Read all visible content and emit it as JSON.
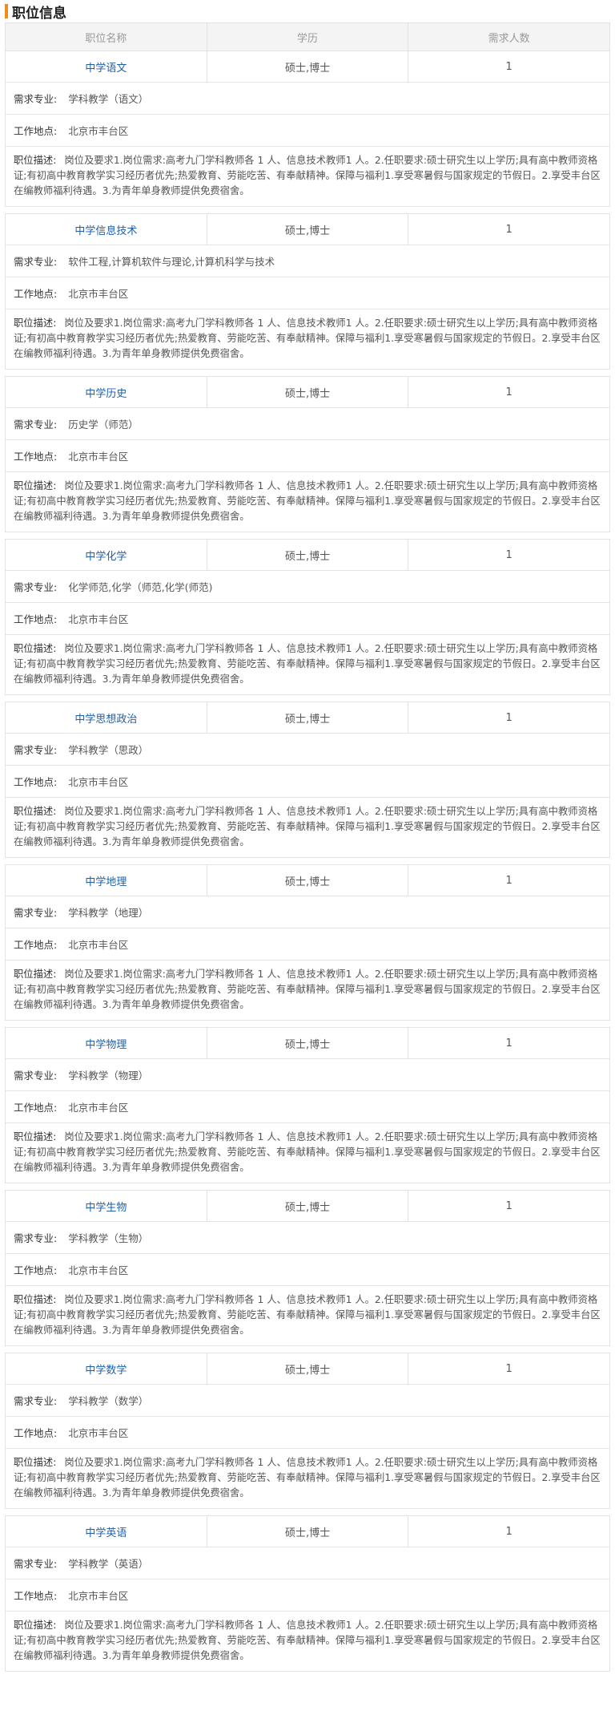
{
  "section": {
    "title": "职位信息"
  },
  "columns": {
    "name": "职位名称",
    "degree": "学历",
    "count": "需求人数"
  },
  "labels": {
    "major": "需求专业:",
    "location": "工作地点:",
    "description": "职位描述:"
  },
  "jobs": [
    {
      "title": "中学语文",
      "degree": "硕士,博士",
      "count": "1",
      "major": "学科教学（语文）",
      "location": "北京市丰台区",
      "description": "岗位及要求1.岗位需求:高考九门学科教师各 1 人、信息技术教师1 人。2.任职要求:硕士研究生以上学历;具有高中教师资格证;有初高中教育教学实习经历者优先;热爱教育、劳能吃苦、有奉献精神。保障与福利1.享受寒暑假与国家规定的节假日。2.享受丰台区在编教师福利待遇。3.为青年单身教师提供免费宿舍。"
    },
    {
      "title": "中学信息技术",
      "degree": "硕士,博士",
      "count": "1",
      "major": "软件工程,计算机软件与理论,计算机科学与技术",
      "location": "北京市丰台区",
      "description": "岗位及要求1.岗位需求:高考九门学科教师各 1 人、信息技术教师1 人。2.任职要求:硕士研究生以上学历;具有高中教师资格证;有初高中教育教学实习经历者优先;热爱教育、劳能吃苦、有奉献精神。保障与福利1.享受寒暑假与国家规定的节假日。2.享受丰台区在编教师福利待遇。3.为青年单身教师提供免费宿舍。"
    },
    {
      "title": "中学历史",
      "degree": "硕士,博士",
      "count": "1",
      "major": "历史学（师范）",
      "location": "北京市丰台区",
      "description": "岗位及要求1.岗位需求:高考九门学科教师各 1 人、信息技术教师1 人。2.任职要求:硕士研究生以上学历;具有高中教师资格证;有初高中教育教学实习经历者优先;热爱教育、劳能吃苦、有奉献精神。保障与福利1.享受寒暑假与国家规定的节假日。2.享受丰台区在编教师福利待遇。3.为青年单身教师提供免费宿舍。"
    },
    {
      "title": "中学化学",
      "degree": "硕士,博士",
      "count": "1",
      "major": "化学师范,化学（师范,化学(师范)",
      "location": "北京市丰台区",
      "description": "岗位及要求1.岗位需求:高考九门学科教师各 1 人、信息技术教师1 人。2.任职要求:硕士研究生以上学历;具有高中教师资格证;有初高中教育教学实习经历者优先;热爱教育、劳能吃苦、有奉献精神。保障与福利1.享受寒暑假与国家规定的节假日。2.享受丰台区在编教师福利待遇。3.为青年单身教师提供免费宿舍。"
    },
    {
      "title": "中学思想政治",
      "degree": "硕士,博士",
      "count": "1",
      "major": "学科教学（思政）",
      "location": "北京市丰台区",
      "description": "岗位及要求1.岗位需求:高考九门学科教师各 1 人、信息技术教师1 人。2.任职要求:硕士研究生以上学历;具有高中教师资格证;有初高中教育教学实习经历者优先;热爱教育、劳能吃苦、有奉献精神。保障与福利1.享受寒暑假与国家规定的节假日。2.享受丰台区在编教师福利待遇。3.为青年单身教师提供免费宿舍。"
    },
    {
      "title": "中学地理",
      "degree": "硕士,博士",
      "count": "1",
      "major": "学科教学（地理）",
      "location": "北京市丰台区",
      "description": "岗位及要求1.岗位需求:高考九门学科教师各 1 人、信息技术教师1 人。2.任职要求:硕士研究生以上学历;具有高中教师资格证;有初高中教育教学实习经历者优先;热爱教育、劳能吃苦、有奉献精神。保障与福利1.享受寒暑假与国家规定的节假日。2.享受丰台区在编教师福利待遇。3.为青年单身教师提供免费宿舍。"
    },
    {
      "title": "中学物理",
      "degree": "硕士,博士",
      "count": "1",
      "major": "学科教学（物理）",
      "location": "北京市丰台区",
      "description": "岗位及要求1.岗位需求:高考九门学科教师各 1 人、信息技术教师1 人。2.任职要求:硕士研究生以上学历;具有高中教师资格证;有初高中教育教学实习经历者优先;热爱教育、劳能吃苦、有奉献精神。保障与福利1.享受寒暑假与国家规定的节假日。2.享受丰台区在编教师福利待遇。3.为青年单身教师提供免费宿舍。"
    },
    {
      "title": "中学生物",
      "degree": "硕士,博士",
      "count": "1",
      "major": "学科教学（生物）",
      "location": "北京市丰台区",
      "description": "岗位及要求1.岗位需求:高考九门学科教师各 1 人、信息技术教师1 人。2.任职要求:硕士研究生以上学历;具有高中教师资格证;有初高中教育教学实习经历者优先;热爱教育、劳能吃苦、有奉献精神。保障与福利1.享受寒暑假与国家规定的节假日。2.享受丰台区在编教师福利待遇。3.为青年单身教师提供免费宿舍。"
    },
    {
      "title": "中学数学",
      "degree": "硕士,博士",
      "count": "1",
      "major": "学科教学（数学）",
      "location": "北京市丰台区",
      "description": "岗位及要求1.岗位需求:高考九门学科教师各 1 人、信息技术教师1 人。2.任职要求:硕士研究生以上学历;具有高中教师资格证;有初高中教育教学实习经历者优先;热爱教育、劳能吃苦、有奉献精神。保障与福利1.享受寒暑假与国家规定的节假日。2.享受丰台区在编教师福利待遇。3.为青年单身教师提供免费宿舍。"
    },
    {
      "title": "中学英语",
      "degree": "硕士,博士",
      "count": "1",
      "major": "学科教学（英语）",
      "location": "北京市丰台区",
      "description": "岗位及要求1.岗位需求:高考九门学科教师各 1 人、信息技术教师1 人。2.任职要求:硕士研究生以上学历;具有高中教师资格证;有初高中教育教学实习经历者优先;热爱教育、劳能吃苦、有奉献精神。保障与福利1.享受寒暑假与国家规定的节假日。2.享受丰台区在编教师福利待遇。3.为青年单身教师提供免费宿舍。"
    }
  ]
}
